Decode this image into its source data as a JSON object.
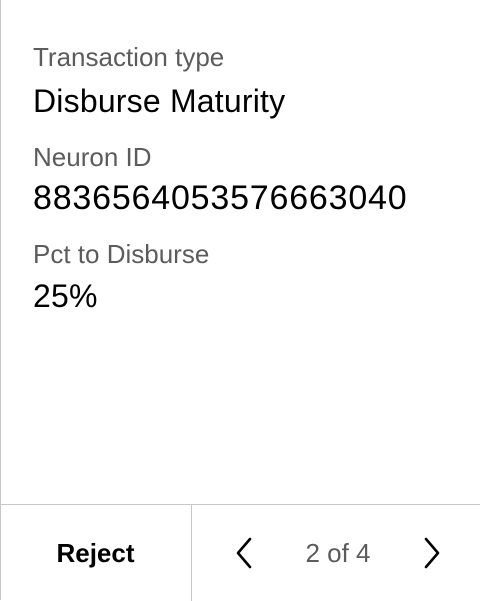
{
  "fields": [
    {
      "label": "Transaction type",
      "value": "Disburse Maturity"
    },
    {
      "label": "Neuron ID",
      "value": "8836564053576663040"
    },
    {
      "label": "Pct to Disburse",
      "value": "25%"
    }
  ],
  "footer": {
    "reject_label": "Reject",
    "pager": {
      "current": 2,
      "total": 4,
      "text": "2 of 4"
    }
  },
  "icons": {
    "prev": "chevron-left-icon",
    "next": "chevron-right-icon"
  }
}
